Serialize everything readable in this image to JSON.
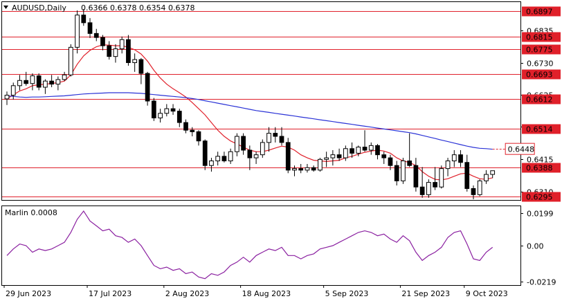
{
  "header": {
    "symbol": "AUDUSD,Daily",
    "ohlc": "0.6366 0.6378 0.6354 0.6378"
  },
  "colors": {
    "bull": "#ffffff",
    "bear": "#000000",
    "wick": "#000000",
    "ma_fast": "#e0202a",
    "ma_slow": "#2a32d6",
    "level": "#e0202a",
    "indicator": "#8a1fa0",
    "grid": "#000000"
  },
  "chart_data": [
    {
      "type": "candlestick",
      "title": "AUDUSD,Daily",
      "ylim": [
        0.6285,
        0.6925
      ],
      "y_ticks": [
        "0.6835",
        "0.6730",
        "0.6625",
        "0.6521",
        "0.6415",
        "0.6310"
      ],
      "x_ticks": [
        "29 Jun 2023",
        "17 Jul 2023",
        "2 Aug 2023",
        "18 Aug 2023",
        "5 Sep 2023",
        "21 Sep 2023",
        "9 Oct 2023"
      ],
      "levels": [
        {
          "label": "0.6897",
          "value": 0.6897
        },
        {
          "label": "0.6815",
          "value": 0.6815
        },
        {
          "label": "0.6775",
          "value": 0.6775
        },
        {
          "label": "0.6693",
          "value": 0.6693
        },
        {
          "label": "0.6612",
          "value": 0.6612
        },
        {
          "label": "0.6514",
          "value": 0.6514
        },
        {
          "label": "0.6388",
          "value": 0.6388
        },
        {
          "label": "0.6295",
          "value": 0.6295
        }
      ],
      "ma_slow_label": "0.6448",
      "ma_slow_label_value": 0.6448,
      "candles": [
        [
          0.6612,
          0.6636,
          0.6592,
          0.6624
        ],
        [
          0.6624,
          0.6665,
          0.661,
          0.6655
        ],
        [
          0.6655,
          0.669,
          0.664,
          0.6672
        ],
        [
          0.6672,
          0.67,
          0.6655,
          0.6662
        ],
        [
          0.6662,
          0.6695,
          0.664,
          0.6687
        ],
        [
          0.6687,
          0.6695,
          0.664,
          0.665
        ],
        [
          0.665,
          0.6676,
          0.6628,
          0.667
        ],
        [
          0.667,
          0.669,
          0.665,
          0.666
        ],
        [
          0.666,
          0.6685,
          0.664,
          0.6675
        ],
        [
          0.6675,
          0.67,
          0.667,
          0.669
        ],
        [
          0.669,
          0.679,
          0.6685,
          0.678
        ],
        [
          0.678,
          0.69,
          0.676,
          0.6885
        ],
        [
          0.6885,
          0.6905,
          0.685,
          0.686
        ],
        [
          0.686,
          0.6875,
          0.681,
          0.6825
        ],
        [
          0.6825,
          0.684,
          0.68,
          0.6812
        ],
        [
          0.6812,
          0.682,
          0.677,
          0.6785
        ],
        [
          0.6785,
          0.68,
          0.674,
          0.675
        ],
        [
          0.675,
          0.679,
          0.673,
          0.6775
        ],
        [
          0.6775,
          0.6815,
          0.676,
          0.6805
        ],
        [
          0.6805,
          0.682,
          0.672,
          0.673
        ],
        [
          0.673,
          0.676,
          0.67,
          0.674
        ],
        [
          0.674,
          0.6745,
          0.666,
          0.6695
        ],
        [
          0.6695,
          0.67,
          0.659,
          0.6605
        ],
        [
          0.6605,
          0.6615,
          0.654,
          0.655
        ],
        [
          0.655,
          0.658,
          0.6535,
          0.6565
        ],
        [
          0.6565,
          0.6595,
          0.6555,
          0.658
        ],
        [
          0.658,
          0.6595,
          0.656,
          0.6572
        ],
        [
          0.6572,
          0.658,
          0.652,
          0.6535
        ],
        [
          0.6535,
          0.6545,
          0.65,
          0.651
        ],
        [
          0.651,
          0.652,
          0.649,
          0.6505
        ],
        [
          0.6505,
          0.651,
          0.646,
          0.6475
        ],
        [
          0.6475,
          0.648,
          0.638,
          0.6395
        ],
        [
          0.6395,
          0.642,
          0.6375,
          0.641
        ],
        [
          0.641,
          0.644,
          0.6395,
          0.6425
        ],
        [
          0.6425,
          0.644,
          0.6405,
          0.641
        ],
        [
          0.641,
          0.645,
          0.64,
          0.644
        ],
        [
          0.644,
          0.65,
          0.6425,
          0.649
        ],
        [
          0.649,
          0.65,
          0.643,
          0.6445
        ],
        [
          0.6445,
          0.646,
          0.638,
          0.642
        ],
        [
          0.642,
          0.644,
          0.64,
          0.643
        ],
        [
          0.643,
          0.648,
          0.642,
          0.647
        ],
        [
          0.647,
          0.652,
          0.644,
          0.65
        ],
        [
          0.65,
          0.652,
          0.647,
          0.649
        ],
        [
          0.649,
          0.652,
          0.646,
          0.647
        ],
        [
          0.647,
          0.6485,
          0.637,
          0.638
        ],
        [
          0.638,
          0.6395,
          0.636,
          0.6385
        ],
        [
          0.6385,
          0.64,
          0.637,
          0.638
        ],
        [
          0.638,
          0.64,
          0.6372,
          0.6388
        ],
        [
          0.6388,
          0.6395,
          0.6375,
          0.638
        ],
        [
          0.638,
          0.642,
          0.6375,
          0.6415
        ],
        [
          0.6415,
          0.644,
          0.639,
          0.642
        ],
        [
          0.642,
          0.6445,
          0.6395,
          0.643
        ],
        [
          0.643,
          0.645,
          0.641,
          0.642
        ],
        [
          0.642,
          0.646,
          0.641,
          0.645
        ],
        [
          0.645,
          0.647,
          0.642,
          0.6435
        ],
        [
          0.6435,
          0.646,
          0.6425,
          0.6455
        ],
        [
          0.6455,
          0.651,
          0.644,
          0.6445
        ],
        [
          0.6445,
          0.647,
          0.643,
          0.646
        ],
        [
          0.646,
          0.6465,
          0.6415,
          0.643
        ],
        [
          0.643,
          0.644,
          0.64,
          0.642
        ],
        [
          0.642,
          0.643,
          0.638,
          0.6395
        ],
        [
          0.6395,
          0.641,
          0.633,
          0.6345
        ],
        [
          0.6345,
          0.642,
          0.6335,
          0.641
        ],
        [
          0.641,
          0.65,
          0.639,
          0.6395
        ],
        [
          0.6395,
          0.642,
          0.631,
          0.6325
        ],
        [
          0.6325,
          0.639,
          0.629,
          0.63
        ],
        [
          0.63,
          0.635,
          0.629,
          0.634
        ],
        [
          0.634,
          0.639,
          0.6315,
          0.6325
        ],
        [
          0.6325,
          0.6395,
          0.632,
          0.6385
        ],
        [
          0.6385,
          0.642,
          0.636,
          0.641
        ],
        [
          0.641,
          0.6445,
          0.639,
          0.643
        ],
        [
          0.643,
          0.6445,
          0.639,
          0.6405
        ],
        [
          0.6405,
          0.643,
          0.631,
          0.632
        ],
        [
          0.632,
          0.633,
          0.6285,
          0.63
        ],
        [
          0.63,
          0.635,
          0.6295,
          0.6345
        ],
        [
          0.6345,
          0.638,
          0.6335,
          0.6366
        ],
        [
          0.6366,
          0.6378,
          0.6354,
          0.6378
        ]
      ],
      "ma_fast": [
        0.6612,
        0.6625,
        0.6638,
        0.6645,
        0.6655,
        0.6658,
        0.666,
        0.6662,
        0.6665,
        0.667,
        0.669,
        0.6725,
        0.6752,
        0.677,
        0.6782,
        0.6788,
        0.6787,
        0.6785,
        0.6785,
        0.678,
        0.6772,
        0.6758,
        0.6735,
        0.6705,
        0.668,
        0.666,
        0.6645,
        0.6632,
        0.6618,
        0.66,
        0.658,
        0.656,
        0.6535,
        0.651,
        0.649,
        0.6475,
        0.6465,
        0.6455,
        0.6445,
        0.644,
        0.644,
        0.6445,
        0.6452,
        0.6458,
        0.6455,
        0.6445,
        0.643,
        0.642,
        0.6412,
        0.641,
        0.6408,
        0.641,
        0.6412,
        0.642,
        0.6425,
        0.6432,
        0.6438,
        0.6442,
        0.6445,
        0.6442,
        0.6435,
        0.642,
        0.641,
        0.6405,
        0.6395,
        0.6375,
        0.636,
        0.635,
        0.6348,
        0.6352,
        0.636,
        0.6368,
        0.637,
        0.636,
        0.6352,
        0.635,
        0.6355
      ],
      "ma_slow": [
        0.6622,
        0.662,
        0.6618,
        0.6617,
        0.6618,
        0.6618,
        0.6619,
        0.662,
        0.6621,
        0.6622,
        0.6624,
        0.6626,
        0.6628,
        0.6629,
        0.663,
        0.6631,
        0.6632,
        0.6632,
        0.6632,
        0.6632,
        0.6631,
        0.663,
        0.6628,
        0.6626,
        0.6624,
        0.6622,
        0.662,
        0.6618,
        0.6616,
        0.6613,
        0.661,
        0.6606,
        0.6602,
        0.6598,
        0.6594,
        0.659,
        0.6586,
        0.6582,
        0.6578,
        0.6574,
        0.6571,
        0.6568,
        0.6565,
        0.6562,
        0.6559,
        0.6556,
        0.6553,
        0.655,
        0.6547,
        0.6544,
        0.6541,
        0.6538,
        0.6535,
        0.6532,
        0.6529,
        0.6526,
        0.6523,
        0.652,
        0.6517,
        0.6514,
        0.6511,
        0.6508,
        0.6505,
        0.6502,
        0.6498,
        0.6493,
        0.6488,
        0.6483,
        0.6478,
        0.6473,
        0.6468,
        0.6463,
        0.6458,
        0.6454,
        0.6451,
        0.645,
        0.6448
      ]
    },
    {
      "type": "line",
      "series_name": "Marlin",
      "label": "Marlin 0.0008",
      "ylim": [
        -0.0235,
        0.0235
      ],
      "y_ticks": [
        "0.0199",
        "0.00",
        "-0.0219"
      ],
      "values": [
        -0.006,
        -0.002,
        0.001,
        0.0,
        -0.004,
        -0.002,
        -0.003,
        -0.002,
        0.0,
        0.002,
        0.008,
        0.016,
        0.021,
        0.015,
        0.012,
        0.009,
        0.01,
        0.006,
        0.005,
        0.002,
        0.004,
        0.0,
        -0.006,
        -0.012,
        -0.014,
        -0.013,
        -0.015,
        -0.014,
        -0.017,
        -0.016,
        -0.019,
        -0.02,
        -0.017,
        -0.018,
        -0.016,
        -0.012,
        -0.01,
        -0.007,
        -0.01,
        -0.006,
        -0.004,
        -0.002,
        -0.003,
        -0.001,
        -0.006,
        -0.006,
        -0.008,
        -0.006,
        -0.005,
        -0.002,
        -0.001,
        0.0,
        0.002,
        0.004,
        0.006,
        0.008,
        0.009,
        0.008,
        0.006,
        0.007,
        0.004,
        0.002,
        0.006,
        0.003,
        -0.004,
        -0.009,
        -0.006,
        -0.004,
        -0.001,
        0.005,
        0.008,
        0.009,
        0.001,
        -0.008,
        -0.009,
        -0.004,
        -0.001
      ]
    }
  ]
}
